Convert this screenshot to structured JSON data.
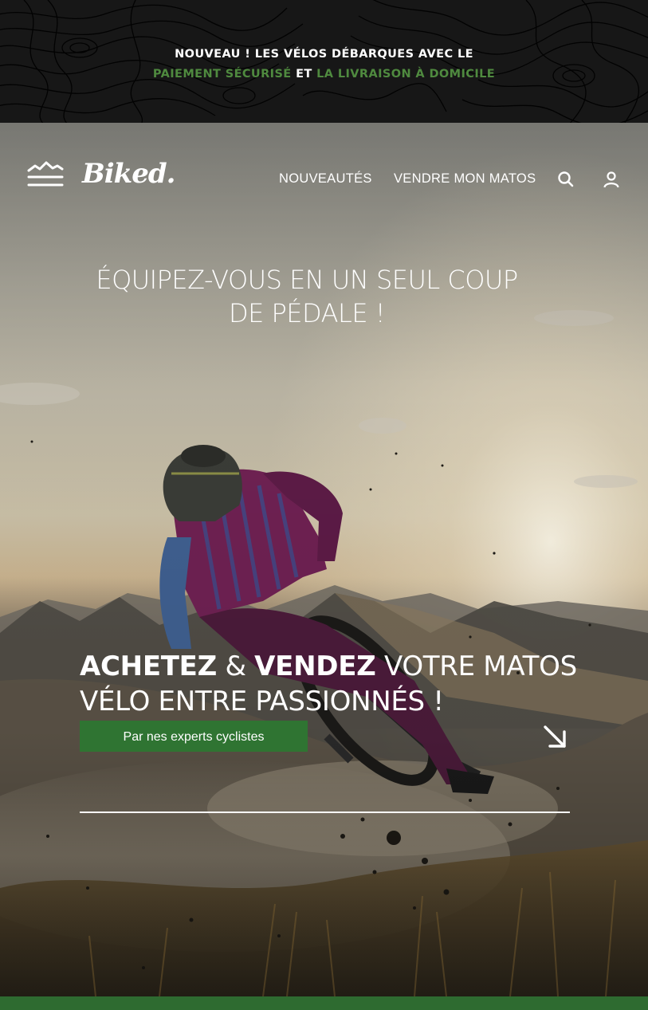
{
  "banner": {
    "line1": "NOUVEAU ! LES VÉLOS DÉBARQUES AVEC LE",
    "highlight1": "PAIEMENT SÉCURISÉ",
    "connector": "ET",
    "highlight2": "LA LIVRAISON À DOMICILE",
    "accent_color": "#4f8a3f"
  },
  "nav": {
    "menu_icon": "menu-mountain-icon",
    "logo": "Biked.",
    "links": [
      {
        "label": "NOUVEAUTÉS"
      },
      {
        "label": "VENDRE MON MATOS"
      }
    ],
    "search_icon": "search-icon",
    "account_icon": "user-icon"
  },
  "hero": {
    "tagline_line1": "ÉQUIPEZ-VOUS EN UN SEUL COUP",
    "tagline_line2": "DE PÉDALE !",
    "headline": {
      "word1": "ACHETEZ",
      "amp": "&",
      "word2": "VENDEZ",
      "rest1": "VOTRE MATOS",
      "line2": "VÉLO ENTRE PASSIONNÉS !"
    },
    "cta_label": "Par nes experts cyclistes",
    "cta_color": "#2f7432",
    "arrow_icon": "arrow-down-right-icon"
  },
  "footer_bar_color": "#2e6b30"
}
